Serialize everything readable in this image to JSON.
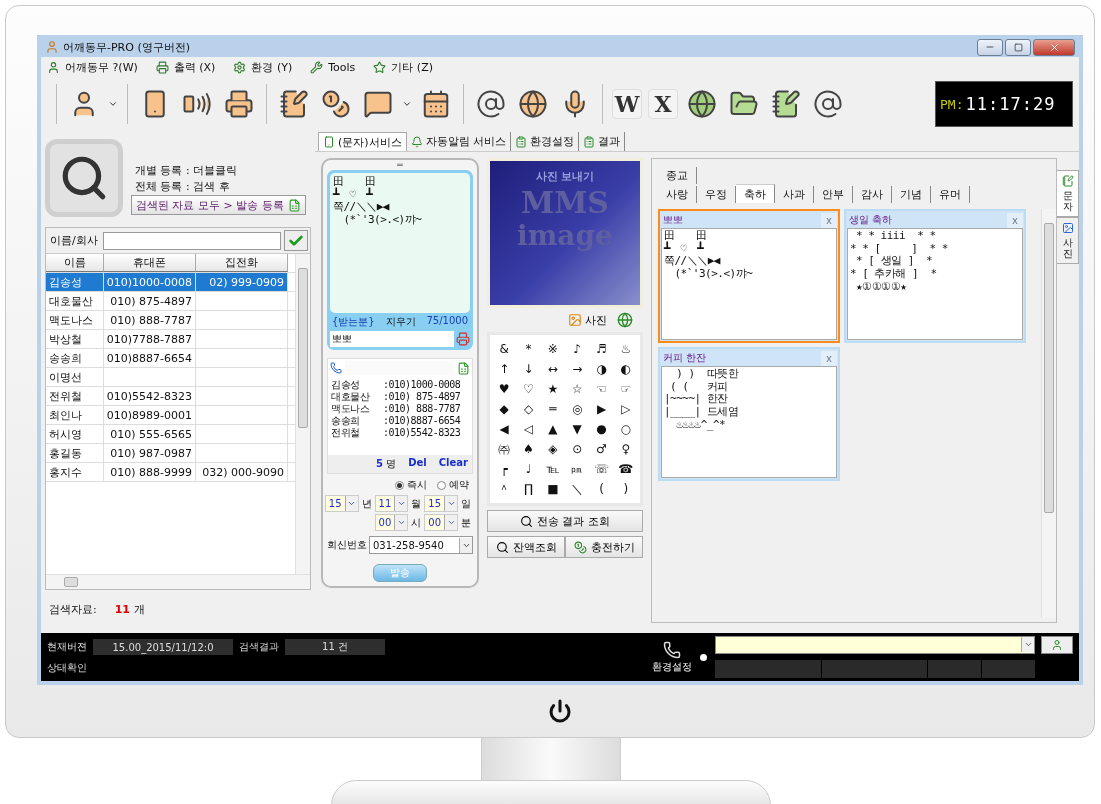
{
  "window": {
    "title": "어깨동무-PRO (영구버전)"
  },
  "menu": [
    {
      "label": "어깨동무 ?(W)"
    },
    {
      "label": "출력 (X)"
    },
    {
      "label": "환경 (Y)"
    },
    {
      "label": "Tools"
    },
    {
      "label": "기타 (Z)"
    }
  ],
  "toolbar": {
    "letter_keys": [
      "W",
      "X"
    ]
  },
  "clock": {
    "period": "PM:",
    "time": "11:17:29"
  },
  "tabs": [
    {
      "label": "(문자)서비스",
      "selected": true
    },
    {
      "label": "자동알림 서비스",
      "selected": false
    },
    {
      "label": "환경설정",
      "selected": false
    },
    {
      "label": "결과",
      "selected": false
    }
  ],
  "search_panel": {
    "hints": [
      "개별 등록 : 더블클릭",
      "전체 등록 : 검색 후"
    ],
    "register_button": "검색된 자료 모두 > 발송 등록",
    "search_label": "이름/회사",
    "columns": [
      "이름",
      "휴대폰",
      "집전화"
    ],
    "rows": [
      {
        "name": "김송성",
        "mobile": "010)1000-0008",
        "home": "02) 999-0909",
        "selected": true
      },
      {
        "name": "대호물산",
        "mobile": "010) 875-4897",
        "selected": false
      },
      {
        "name": "맥도나스",
        "mobile": "010) 888-7787",
        "selected": false
      },
      {
        "name": "박상철",
        "mobile": "010)7788-7887",
        "selected": false
      },
      {
        "name": "송송희",
        "mobile": "010)8887-6654",
        "selected": false
      },
      {
        "name": "이명선",
        "selected": false
      },
      {
        "name": "전위철",
        "mobile": "010)5542-8323",
        "selected": false
      },
      {
        "name": "최인나",
        "mobile": "010)8989-0001",
        "selected": false
      },
      {
        "name": "허시영",
        "mobile": "010) 555-6565",
        "selected": false
      },
      {
        "name": "홍길동",
        "mobile": "010) 987-0987",
        "selected": false
      },
      {
        "name": "홍지수",
        "mobile": "010) 888-9999",
        "home": "032) 000-9090",
        "selected": false
      }
    ],
    "result_label": "검색자료:",
    "result_count": "11",
    "result_unit": "개"
  },
  "phone": {
    "handle": "═",
    "message": [
      "田　　田",
      "┻　♡　┻",
      "쪽//＼＼▶◀",
      "　(*`'3(>.<)꺄~"
    ],
    "recipient_label": "{받는분}",
    "clear_label": "지우기",
    "char_count": "75/1000",
    "title_value": "뽀뽀",
    "recipients": [
      {
        "name": "김송성",
        "number": ":010)1000-0008"
      },
      {
        "name": "대호물산",
        "number": ":010) 875-4897"
      },
      {
        "name": "맥도나스",
        "number": ":010) 888-7787"
      },
      {
        "name": "송송희",
        "number": ":010)8887-6654"
      },
      {
        "name": "전위철",
        "number": ":010)5542-8323"
      }
    ],
    "count": "5",
    "count_unit": "명",
    "del_label": "Del",
    "clear_all_label": "Clear",
    "timing": [
      {
        "label": "즉시",
        "selected": true
      },
      {
        "label": "예약",
        "selected": false
      }
    ],
    "date": [
      {
        "value": "15",
        "unit": "년"
      },
      {
        "value": "11",
        "unit": "월"
      },
      {
        "value": "15",
        "unit": "일"
      }
    ],
    "time": [
      {
        "value": "00",
        "unit": "시"
      },
      {
        "value": "00",
        "unit": "분"
      }
    ],
    "reply_label": "회신번호",
    "reply_number": "031-258-9540",
    "send_button": "발송"
  },
  "mms": {
    "banner": [
      "사진 보내기",
      "MMS",
      "image"
    ],
    "photo_button": "사진",
    "symbols": [
      [
        "&",
        "*",
        "※",
        "♪",
        "♬",
        "♨"
      ],
      [
        "↑",
        "↓",
        "↔",
        "→",
        "◑",
        "◐"
      ],
      [
        "♥",
        "♡",
        "★",
        "☆",
        "☜",
        "☞"
      ],
      [
        "◆",
        "◇",
        "═",
        "◎",
        "▶",
        "▷"
      ],
      [
        "◀",
        "◁",
        "▲",
        "▼",
        "●",
        "○"
      ],
      [
        "㈜",
        "♠",
        "◈",
        "⊙",
        "♂",
        "♀"
      ],
      [
        "┍",
        "♩",
        "℡",
        "㏘",
        "☏",
        "☎"
      ],
      [
        "＾",
        "∏",
        "■",
        "＼",
        "(",
        ")"
      ]
    ],
    "result_button": "전송 결과 조회",
    "balance_button": "잔액조회",
    "charge_button": "충전하기"
  },
  "templates": {
    "tab_rows": [
      [
        {
          "label": "종교",
          "selected": false
        }
      ],
      [
        {
          "label": "사랑",
          "selected": false
        },
        {
          "label": "우정",
          "selected": false
        },
        {
          "label": "축하",
          "selected": true
        },
        {
          "label": "사과",
          "selected": false
        },
        {
          "label": "안부",
          "selected": false
        },
        {
          "label": "감사",
          "selected": false
        },
        {
          "label": "기념",
          "selected": false
        },
        {
          "label": "유머",
          "selected": false
        }
      ]
    ],
    "cards": [
      {
        "title": "뽀뽀",
        "selected": true,
        "close": "x",
        "lines": [
          "田　　田",
          "┻　♡　┻",
          "쪽//＼＼▶◀",
          "　(*`'3(>.<)꺄~"
        ]
      },
      {
        "title": "생일 축하",
        "selected": false,
        "close": "x",
        "lines": [
          " * * iiii  * *",
          "* * [     ]  * *",
          " * [ 생일 ]  *",
          "* [ 추카해 ]  *",
          " ★①①①①★"
        ]
      },
      {
        "title": "커피 한잔",
        "selected": false,
        "close": "x",
        "lines": [
          "  ) )  따뜻한",
          " ( (   커피",
          "|~~~~| 한잔",
          "|____| 드세염",
          "  ♨♨♨♨^_^*"
        ]
      }
    ],
    "side_tabs": [
      {
        "label": "문자",
        "selected": true
      },
      {
        "label": "사진",
        "selected": false
      }
    ]
  },
  "status_bar": {
    "version_label": "현재버젼",
    "version": "15.00_2015/11/12:0",
    "result_label": "검색결과",
    "result": "11 건",
    "status_label": "상태확인",
    "settings_label": "환경설정"
  }
}
